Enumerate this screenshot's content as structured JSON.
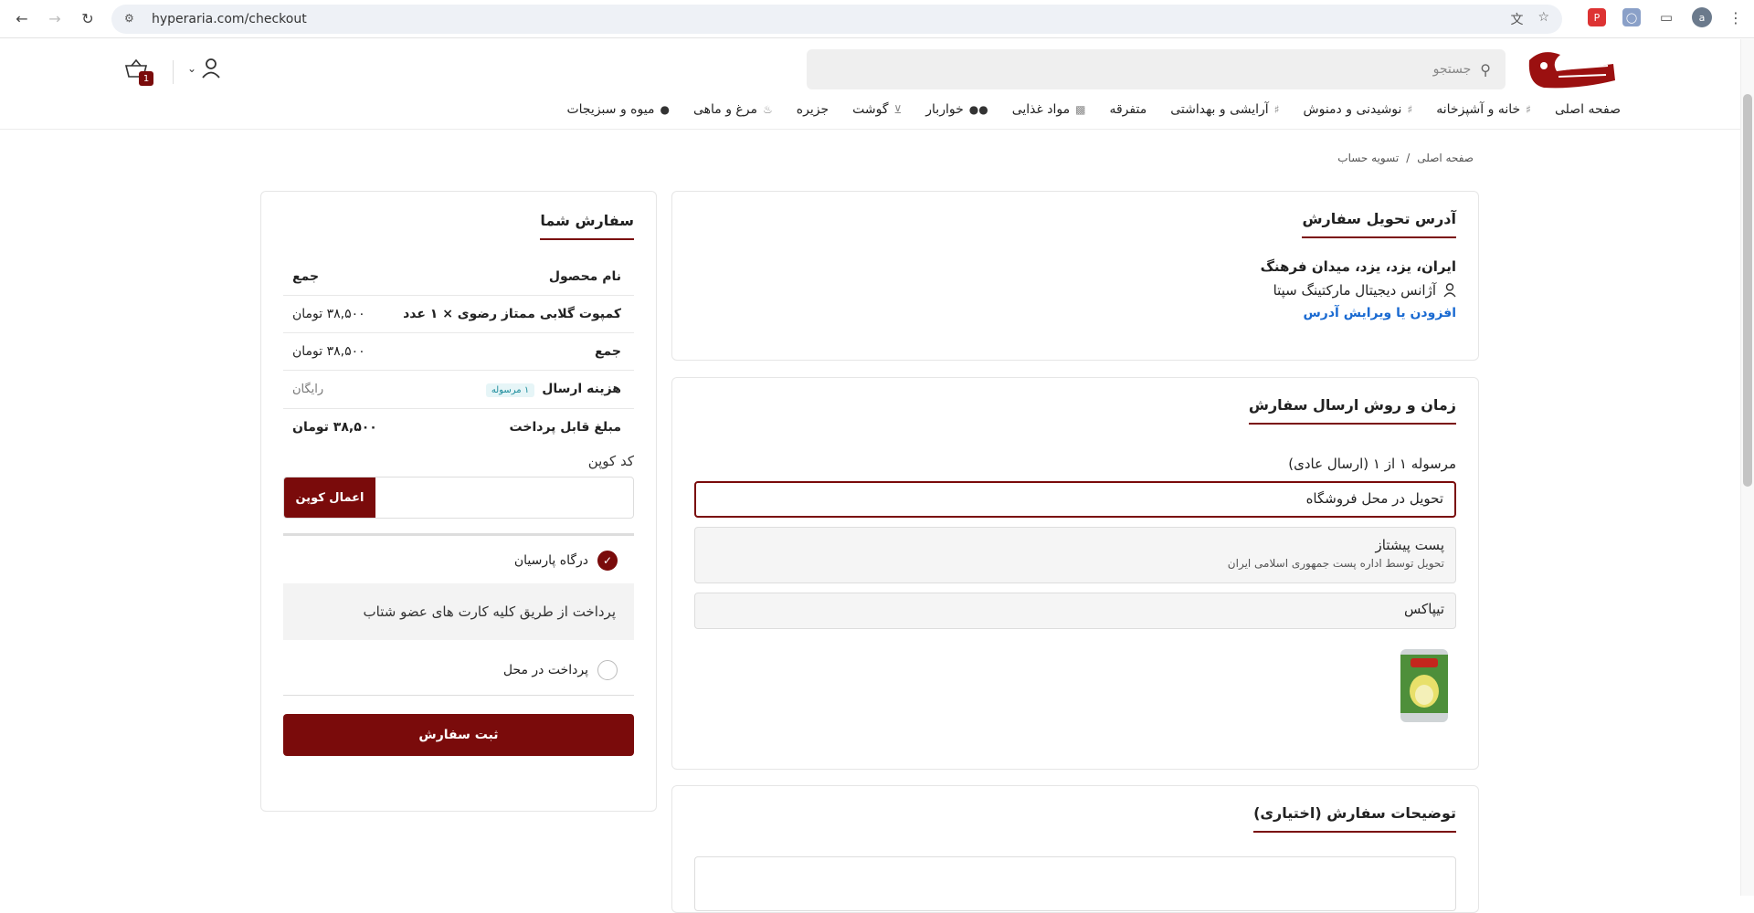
{
  "browser": {
    "url": "hyperaria.com/checkout",
    "profile_initial": "a"
  },
  "header": {
    "search_placeholder": "جستجو",
    "cart_count": "1",
    "menu": [
      {
        "label": "صفحه اصلی"
      },
      {
        "label": "خانه و آشپزخانه"
      },
      {
        "label": "نوشیدنی و دمنوش"
      },
      {
        "label": "آرایشی و بهداشتی"
      },
      {
        "label": "متفرقه"
      },
      {
        "label": "مواد غذایی"
      },
      {
        "label": "خواربار"
      },
      {
        "label": "گوشت"
      },
      {
        "label": "جزیره"
      },
      {
        "label": "مرغ و ماهی"
      },
      {
        "label": "میوه و سبزیجات"
      }
    ]
  },
  "breadcrumb": {
    "home": "صفحه اصلی",
    "sep": "/",
    "current": "تسویه حساب"
  },
  "address": {
    "title": "آدرس تحویل سفارش",
    "line1": "ایران، یزد، یزد، میدان فرهنگ",
    "recipient": "آژانس دیجیتال مارکتینگ سپتا",
    "edit_link": "افزودن یا ویرایش آدرس"
  },
  "shipping": {
    "title": "زمان و روش ارسال سفارش",
    "subtitle": "مرسوله ۱ از ۱ (ارسال عادی)",
    "options": [
      {
        "label": "تحویل در محل فروشگاه",
        "desc": ""
      },
      {
        "label": "پست پیشتاز",
        "desc": "تحویل توسط اداره پست جمهوری اسلامی ایران"
      },
      {
        "label": "تیپاکس",
        "desc": ""
      }
    ]
  },
  "notes": {
    "title": "توضیحات سفارش (اختیاری)"
  },
  "summary": {
    "title": "سفارش شما",
    "col_product": "نام محصول",
    "col_total": "جمع",
    "item_name": "کمپوت گلابی ممتاز رضوی × ۱ عدد",
    "item_price": "۳۸,۵۰۰ تومان",
    "subtotal_label": "جمع",
    "subtotal_value": "۳۸,۵۰۰ تومان",
    "shipping_label": "هزینه ارسال",
    "shipping_badge": "۱ مرسوله",
    "shipping_value": "رایگان",
    "payable_label": "مبلغ قابل پرداخت",
    "payable_value": "۳۸,۵۰۰ تومان",
    "coupon_label": "کد کوپن",
    "coupon_button": "اعمال کوپن",
    "gateway_label": "درگاه پارسیان",
    "gateway_desc": "پرداخت از طریق کلیه کارت های عضو شتاب",
    "cod_label": "پرداخت در محل",
    "submit_label": "ثبت سفارش"
  },
  "colors": {
    "brand": "#7a0b0b",
    "link": "#1a6ad1"
  }
}
